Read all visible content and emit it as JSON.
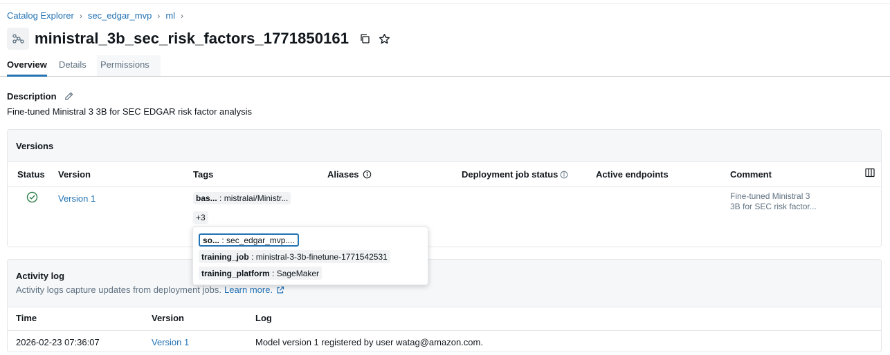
{
  "breadcrumb": {
    "items": [
      "Catalog Explorer",
      "sec_edgar_mvp",
      "ml"
    ],
    "separator": "›"
  },
  "page": {
    "title": "ministral_3b_sec_risk_factors_1771850161",
    "icons": {
      "model": "model-graph-icon",
      "copy": "copy-icon",
      "favorite": "star-icon"
    }
  },
  "tabs": [
    {
      "label": "Overview",
      "active": true
    },
    {
      "label": "Details",
      "active": false
    },
    {
      "label": "Permissions",
      "active": false
    }
  ],
  "description": {
    "label": "Description",
    "text": "Fine-tuned Ministral 3 3B for SEC EDGAR risk factor analysis"
  },
  "versions": {
    "title": "Versions",
    "columns": {
      "status": "Status",
      "version": "Version",
      "tags": "Tags",
      "aliases": "Aliases",
      "deployment_job_status": "Deployment job status",
      "active_endpoints": "Active endpoints",
      "comment": "Comment"
    },
    "rows": [
      {
        "status": "ready",
        "version": "Version 1",
        "tag_key": "bas...",
        "tag_value": "mistralai/Ministr...",
        "more_tags": "+3",
        "comment_line1": "Fine-tuned Ministral 3",
        "comment_line2": "3B for SEC risk factor..."
      }
    ]
  },
  "tag_popover": [
    {
      "key": "so...",
      "value": "sec_edgar_mvp...."
    },
    {
      "key": "training_job",
      "value": "ministral-3-3b-finetune-1771542531"
    },
    {
      "key": "training_platform",
      "value": "SageMaker"
    }
  ],
  "activity": {
    "title": "Activity log",
    "subtitle": "Activity logs capture updates from deployment jobs.",
    "learn_more": "Learn more.",
    "columns": {
      "time": "Time",
      "version": "Version",
      "log": "Log"
    },
    "rows": [
      {
        "time": "2026-02-23 07:36:07",
        "version": "Version 1",
        "log": "Model version 1 registered by user watag@amazon.com."
      }
    ]
  },
  "colors": {
    "link": "#2272b4",
    "success": "#277c43",
    "muted": "#5f7281",
    "border": "#e4e6e9",
    "panel_bg": "#f6f7f9"
  }
}
